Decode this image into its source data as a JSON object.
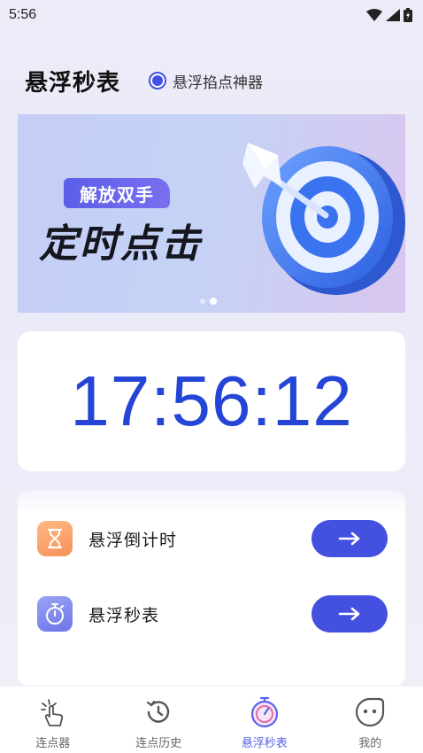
{
  "status_bar": {
    "time": "5:56"
  },
  "header": {
    "title": "悬浮秒表",
    "mode_label": "悬浮掐点神器"
  },
  "banner": {
    "tag": "解放双手",
    "headline": "定时点击",
    "active_slide": 2,
    "slide_count": 2
  },
  "clock": {
    "time": "17:56:12"
  },
  "tools": [
    {
      "label": "悬浮倒计时",
      "icon": "hourglass-icon"
    },
    {
      "label": "悬浮秒表",
      "icon": "stopwatch-icon"
    }
  ],
  "tabbar": [
    {
      "label": "连点器",
      "icon": "tap-finger-icon",
      "active": false
    },
    {
      "label": "连点历史",
      "icon": "history-icon",
      "active": false
    },
    {
      "label": "悬浮秒表",
      "icon": "stopwatch-icon",
      "active": true
    },
    {
      "label": "我的",
      "icon": "face-icon",
      "active": false
    }
  ],
  "colors": {
    "accent": "#4350e0",
    "clock": "#2445d6",
    "active_tab": "#5a62e8"
  }
}
